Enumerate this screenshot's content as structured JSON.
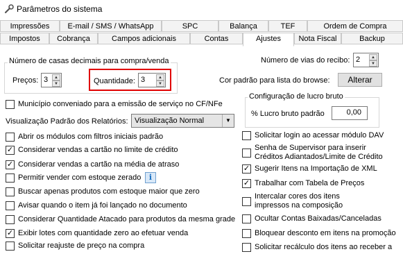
{
  "window": {
    "title": "Parâmetros do sistema"
  },
  "tabs_row1": [
    {
      "label": "Impressões"
    },
    {
      "label": "E-mail / SMS / WhatsApp"
    },
    {
      "label": "SPC"
    },
    {
      "label": "Balança"
    },
    {
      "label": "TEF"
    },
    {
      "label": "Ordem de Compra"
    }
  ],
  "tabs_row2": [
    {
      "label": "Impostos"
    },
    {
      "label": "Cobrança"
    },
    {
      "label": "Campos adicionais"
    },
    {
      "label": "Contas"
    },
    {
      "label": "Ajustes",
      "active": true
    },
    {
      "label": "Nota Fiscal"
    },
    {
      "label": "Backup"
    }
  ],
  "decimals": {
    "legend": "Número de casas decimais para compra/venda",
    "prices_label": "Preços:",
    "prices_value": "3",
    "quantity_label": "Quantidade:",
    "quantity_value": "3",
    "highlight_color": "#e00000"
  },
  "receipt": {
    "label": "Número de vias do recibo:",
    "value": "2"
  },
  "browse_color": {
    "label": "Cor padrão para lista do browse:",
    "button": "Alterar"
  },
  "profit": {
    "legend": "Configuração de lucro bruto",
    "label": "% Lucro bruto padrão",
    "value": "0,00"
  },
  "municipio": {
    "label": "Município conveniado para a emissão de serviço no CF/NFe",
    "checked": false
  },
  "view_mode": {
    "label": "Visualização Padrão dos Relatórios:",
    "selected": "Visualização Normal"
  },
  "left_options": [
    {
      "label": "Abrir os módulos com filtros iniciais padrão",
      "checked": false
    },
    {
      "label": "Considerar vendas a cartão no limite de crédito",
      "checked": true
    },
    {
      "label": "Considerar vendas a cartão na média de atraso",
      "checked": true
    },
    {
      "label": "Permitir vender com estoque zerado",
      "checked": false
    },
    {
      "label": "Buscar apenas produtos com estoque maior que zero",
      "checked": false
    },
    {
      "label": "Avisar quando o item já foi lançado no documento",
      "checked": false
    },
    {
      "label": "Considerar Quantidade Atacado para produtos da mesma grade",
      "checked": false
    },
    {
      "label": "Exibir lotes com quantidade zero ao efetuar venda",
      "checked": true
    },
    {
      "label": "Solicitar reajuste de preço na compra",
      "checked": false
    }
  ],
  "right_options": [
    {
      "label": "Solicitar login ao acessar módulo DAV",
      "checked": false
    },
    {
      "label": "Senha de Supervisor para inserir",
      "label2": "Créditos Adiantados/Limite de Crédito",
      "checked": false
    },
    {
      "label": "Sugerir Itens na Importação de XML",
      "checked": true
    },
    {
      "label": "Trabalhar com Tabela de Preços",
      "checked": true
    },
    {
      "label": "Intercalar cores dos itens",
      "label2": "impressos na composição",
      "checked": false
    },
    {
      "label": "Ocultar Contas Baixadas/Canceladas",
      "checked": false
    },
    {
      "label": "Bloquear desconto em itens na promoção",
      "checked": false
    },
    {
      "label": "Solicitar recálculo dos itens ao receber a",
      "checked": false
    }
  ],
  "icons": {
    "app": "wrench-icon",
    "info": "info-icon"
  }
}
